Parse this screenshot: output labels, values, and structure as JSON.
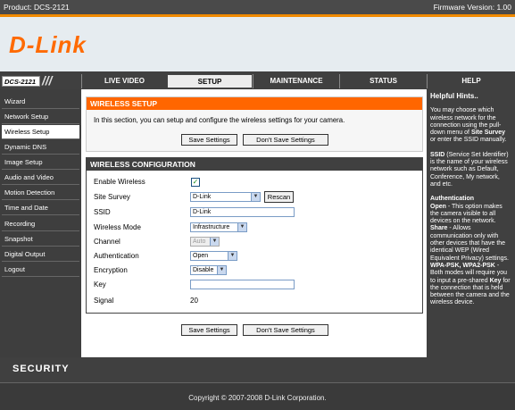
{
  "header": {
    "product": "Product: DCS-2121",
    "firmware": "Firmware Version: 1.00",
    "logo": "D-Link",
    "model": "DCS-2121"
  },
  "tabs": [
    {
      "label": "LIVE VIDEO"
    },
    {
      "label": "SETUP"
    },
    {
      "label": "MAINTENANCE"
    },
    {
      "label": "STATUS"
    },
    {
      "label": "HELP"
    }
  ],
  "sidebar": {
    "items": [
      {
        "label": "Wizard"
      },
      {
        "label": "Network Setup"
      },
      {
        "label": "Wireless Setup"
      },
      {
        "label": "Dynamic DNS"
      },
      {
        "label": "Image Setup"
      },
      {
        "label": "Audio and Video"
      },
      {
        "label": "Motion Detection"
      },
      {
        "label": "Time and Date"
      },
      {
        "label": "Recording"
      },
      {
        "label": "Snapshot"
      },
      {
        "label": "Digital Output"
      },
      {
        "label": "Logout"
      }
    ]
  },
  "wireless_setup": {
    "title": "WIRELESS SETUP",
    "description": "In this section, you can setup and configure the wireless settings for your camera.",
    "save_label": "Save Settings",
    "dont_save_label": "Don't Save Settings"
  },
  "wireless_config": {
    "title": "WIRELESS CONFIGURATION",
    "enable_label": "Enable Wireless",
    "enable_checked": "✓",
    "survey_label": "Site Survey",
    "survey_value": "D-Link",
    "rescan_label": "Rescan",
    "ssid_label": "SSID",
    "ssid_value": "D-Link",
    "mode_label": "Wireless Mode",
    "mode_value": "Infrastructure",
    "channel_label": "Channel",
    "channel_value": "Auto",
    "auth_label": "Authentication",
    "auth_value": "Open",
    "enc_label": "Encryption",
    "enc_value": "Disable",
    "key_label": "Key",
    "key_value": "",
    "signal_label": "Signal",
    "signal_value": "20"
  },
  "bottom_buttons": {
    "save_label": "Save Settings",
    "dont_save_label": "Don't Save Settings"
  },
  "help": {
    "title": "Helpful Hints..",
    "p1_pre": "You may choose which wireless network for the connection using the pull-down menu of",
    "p1_b1": "Site Survey",
    "p1_post": "or enter the SSID manually.",
    "p2_b": "SSID",
    "p2_text": "(Service Set Identifier) is the name of your wireless network such as Default, Conference, My network, and etc.",
    "p3_title": "Authentication",
    "p3_open_b": "Open",
    "p3_open_text": "- This option makes the camera visible to all devices on the network.",
    "p3_share_b": "Share",
    "p3_share_text": "- Allows communication only with other devices that have the identical WEP (Wired Equivalent Privacy) settings.",
    "p3_wpa_b": "WPA-PSK, WPA2-PSK",
    "p3_wpa_text": "- Both modes will require you to input a pre-shared",
    "p3_key_b": "Key",
    "p3_key_text": "for the connection that is held between the camera and the wireless device."
  },
  "footer": {
    "security": "SECURITY",
    "copyright": "Copyright © 2007-2008 D-Link Corporation."
  },
  "colors": {
    "accent": "#ff6600",
    "dark": "#404040"
  }
}
